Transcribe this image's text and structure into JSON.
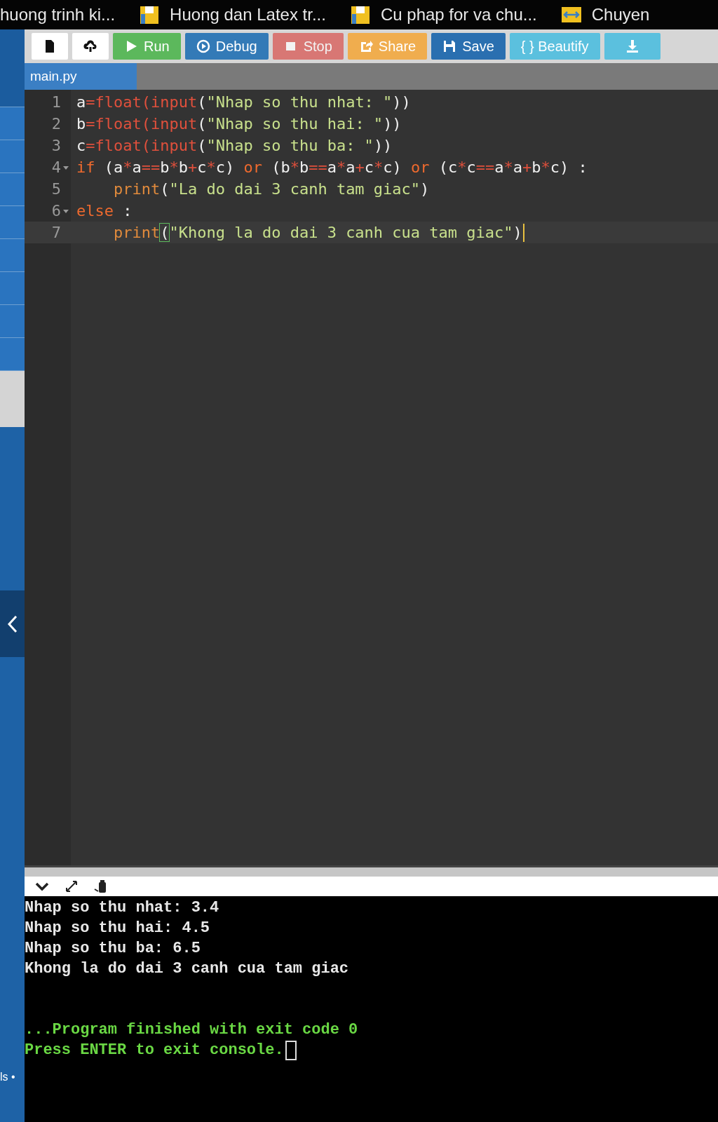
{
  "bookmarks": [
    {
      "kind": "plain",
      "label": "huong trinh ki..."
    },
    {
      "kind": "doc",
      "label": "Huong dan Latex tr..."
    },
    {
      "kind": "doc",
      "label": "Cu phap for va chu..."
    },
    {
      "kind": "arrows",
      "label": "Chuyen"
    }
  ],
  "toolbar": [
    {
      "kind": "new",
      "disabled": false
    },
    {
      "kind": "upload",
      "disabled": false
    },
    {
      "kind": "run",
      "label": "Run",
      "disabled": false
    },
    {
      "kind": "debug",
      "label": "Debug",
      "disabled": false
    },
    {
      "kind": "stop",
      "label": "Stop",
      "disabled": true
    },
    {
      "kind": "share",
      "label": "Share",
      "disabled": false
    },
    {
      "kind": "save",
      "label": "Save",
      "disabled": false
    },
    {
      "kind": "beautify",
      "label": "{ } Beautify",
      "disabled": false
    },
    {
      "kind": "download",
      "disabled": false
    }
  ],
  "tabs": [
    {
      "label": "main.py",
      "selected": true
    }
  ],
  "code_lines": [
    {
      "number": "1",
      "foldable": false,
      "active": false,
      "tokens": [
        {
          "kind": "plain",
          "text": "a"
        },
        {
          "kind": "op",
          "text": "=float("
        },
        {
          "kind": "op",
          "text": "input"
        },
        {
          "kind": "plain",
          "text": "("
        },
        {
          "kind": "string",
          "text": "\"Nhap so thu nhat: \""
        },
        {
          "kind": "plain",
          "text": "))"
        }
      ]
    },
    {
      "number": "2",
      "foldable": false,
      "active": false,
      "tokens": [
        {
          "kind": "plain",
          "text": "b"
        },
        {
          "kind": "op",
          "text": "=float("
        },
        {
          "kind": "op",
          "text": "input"
        },
        {
          "kind": "plain",
          "text": "("
        },
        {
          "kind": "string",
          "text": "\"Nhap so thu hai: \""
        },
        {
          "kind": "plain",
          "text": "))"
        }
      ]
    },
    {
      "number": "3",
      "foldable": false,
      "active": false,
      "tokens": [
        {
          "kind": "plain",
          "text": "c"
        },
        {
          "kind": "op",
          "text": "=float("
        },
        {
          "kind": "op",
          "text": "input"
        },
        {
          "kind": "plain",
          "text": "("
        },
        {
          "kind": "string",
          "text": "\"Nhap so thu ba: \""
        },
        {
          "kind": "plain",
          "text": "))"
        }
      ]
    },
    {
      "number": "4",
      "foldable": true,
      "active": false,
      "tokens": [
        {
          "kind": "keyword",
          "text": "if"
        },
        {
          "kind": "plain",
          "text": " (a"
        },
        {
          "kind": "op",
          "text": "*"
        },
        {
          "kind": "plain",
          "text": "a"
        },
        {
          "kind": "op",
          "text": "=="
        },
        {
          "kind": "plain",
          "text": "b"
        },
        {
          "kind": "op",
          "text": "*"
        },
        {
          "kind": "plain",
          "text": "b"
        },
        {
          "kind": "op",
          "text": "+"
        },
        {
          "kind": "plain",
          "text": "c"
        },
        {
          "kind": "op",
          "text": "*"
        },
        {
          "kind": "plain",
          "text": "c) "
        },
        {
          "kind": "keyword",
          "text": "or"
        },
        {
          "kind": "plain",
          "text": " (b"
        },
        {
          "kind": "op",
          "text": "*"
        },
        {
          "kind": "plain",
          "text": "b"
        },
        {
          "kind": "op",
          "text": "=="
        },
        {
          "kind": "plain",
          "text": "a"
        },
        {
          "kind": "op",
          "text": "*"
        },
        {
          "kind": "plain",
          "text": "a"
        },
        {
          "kind": "op",
          "text": "+"
        },
        {
          "kind": "plain",
          "text": "c"
        },
        {
          "kind": "op",
          "text": "*"
        },
        {
          "kind": "plain",
          "text": "c) "
        },
        {
          "kind": "keyword",
          "text": "or"
        },
        {
          "kind": "plain",
          "text": " (c"
        },
        {
          "kind": "op",
          "text": "*"
        },
        {
          "kind": "plain",
          "text": "c"
        },
        {
          "kind": "op",
          "text": "=="
        },
        {
          "kind": "plain",
          "text": "a"
        },
        {
          "kind": "op",
          "text": "*"
        },
        {
          "kind": "plain",
          "text": "a"
        },
        {
          "kind": "op",
          "text": "+"
        },
        {
          "kind": "plain",
          "text": "b"
        },
        {
          "kind": "op",
          "text": "*"
        },
        {
          "kind": "plain",
          "text": "c) :"
        }
      ]
    },
    {
      "number": "5",
      "foldable": false,
      "active": false,
      "tokens": [
        {
          "kind": "builtin",
          "text": "    print"
        },
        {
          "kind": "plain",
          "text": "("
        },
        {
          "kind": "string",
          "text": "\"La do dai 3 canh tam giac\""
        },
        {
          "kind": "plain",
          "text": ")"
        }
      ]
    },
    {
      "number": "6",
      "foldable": true,
      "active": false,
      "tokens": [
        {
          "kind": "keyword",
          "text": "else"
        },
        {
          "kind": "plain",
          "text": " :"
        }
      ]
    },
    {
      "number": "7",
      "foldable": false,
      "active": true,
      "tokens": [
        {
          "kind": "builtin",
          "text": "    print"
        },
        {
          "kind": "bracket",
          "text": "("
        },
        {
          "kind": "string",
          "text": "\"Khong la do dai 3 canh cua tam giac\""
        },
        {
          "kind": "plain",
          "text": ")"
        }
      ]
    }
  ],
  "console": {
    "output_lines": [
      "Nhap so thu nhat: 3.4",
      "Nhap so thu hai: 4.5",
      "Nhap so thu ba: 6.5",
      "Khong la do dai 3 canh cua tam giac"
    ],
    "exit_lines": [
      "...Program finished with exit code 0",
      "Press ENTER to exit console."
    ]
  },
  "sidebar": {
    "footer_text": "ls •"
  }
}
